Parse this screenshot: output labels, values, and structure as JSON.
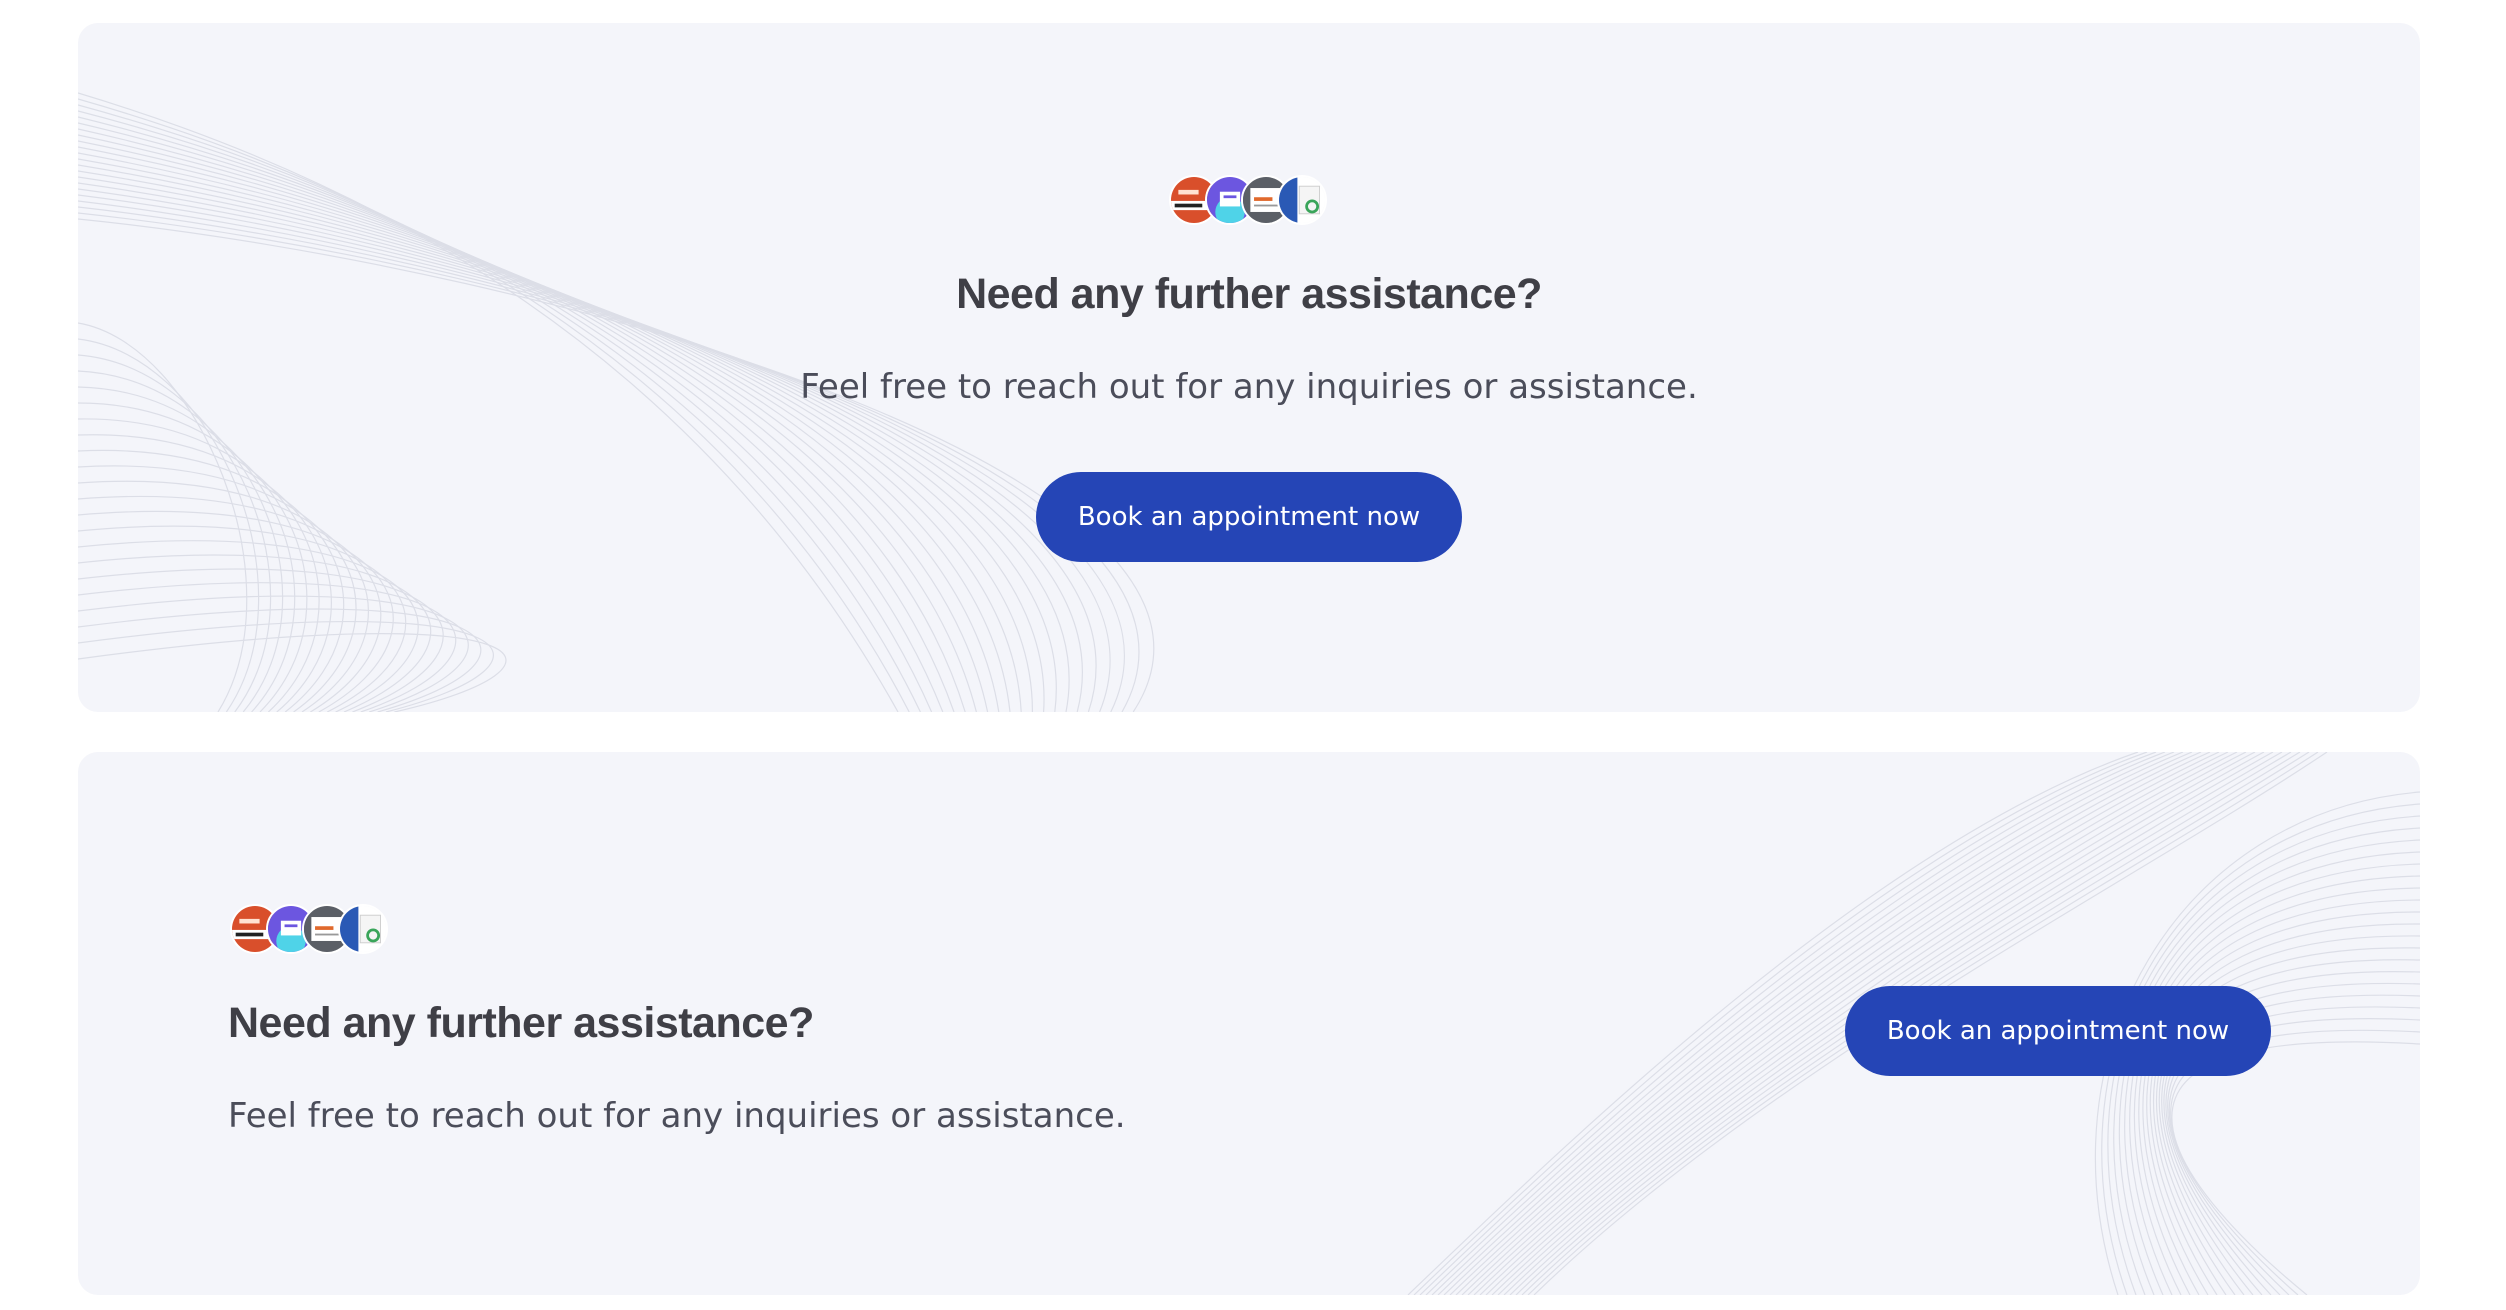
{
  "cards": [
    {
      "heading": "Need any further assistance?",
      "subtext": "Feel free to reach out for any inquiries or assistance.",
      "button_label": "Book an appointment now",
      "avatars": [
        "promo-thumbnail-red",
        "promo-thumbnail-purple",
        "promo-thumbnail-gray",
        "promo-thumbnail-blue"
      ]
    },
    {
      "heading": "Need any further assistance?",
      "subtext": "Feel free to reach out for any inquiries or assistance.",
      "button_label": "Book an appointment now",
      "avatars": [
        "promo-thumbnail-red",
        "promo-thumbnail-purple",
        "promo-thumbnail-gray",
        "promo-thumbnail-blue"
      ]
    }
  ],
  "colors": {
    "card_background": "#f4f5fa",
    "button_background": "#2545b6",
    "heading_text": "#3f3f46",
    "body_text": "#4b4d5a"
  }
}
